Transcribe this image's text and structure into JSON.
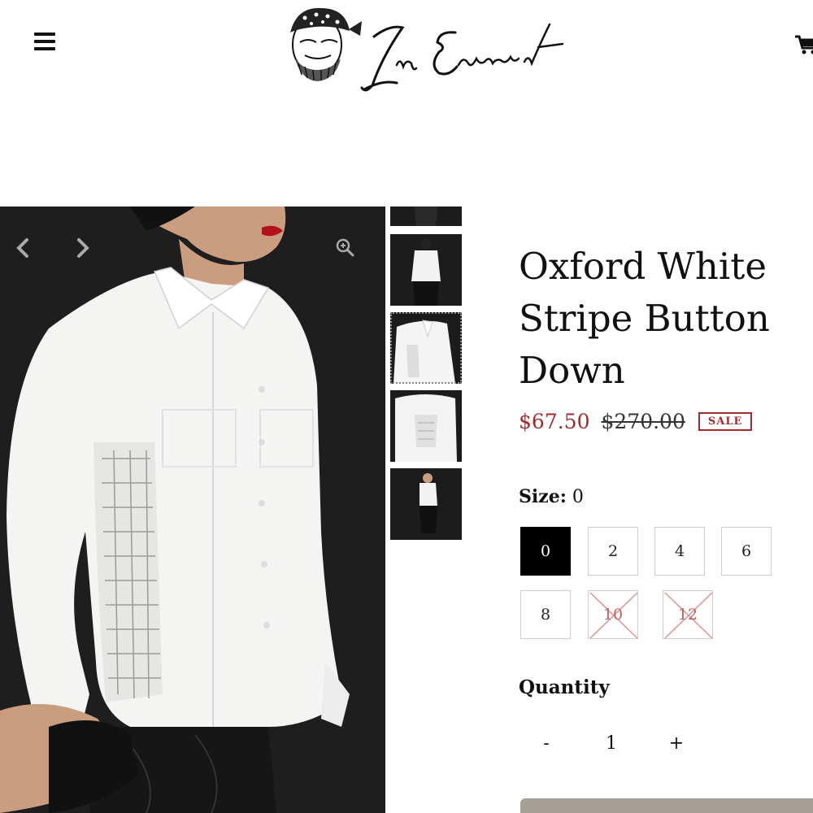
{
  "header": {
    "brand": "In Earnest",
    "menu_icon": "hamburger-menu-icon",
    "cart_icon": "shopping-cart-icon"
  },
  "gallery": {
    "prev_icon": "chevron-left-icon",
    "next_icon": "chevron-right-icon",
    "zoom_icon": "zoom-in-icon",
    "thumbnails": [
      "thumbnail-1",
      "thumbnail-2",
      "thumbnail-3",
      "thumbnail-4",
      "thumbnail-5"
    ]
  },
  "product": {
    "title": "Oxford White\nStripe Button\nDown",
    "sale_price": "$67.50",
    "original_price": "$270.00",
    "badge": "SALE",
    "accent_color": "#a52a2a"
  },
  "size": {
    "label": "Size:",
    "selected": "0",
    "options": [
      {
        "value": "0",
        "state": "selected"
      },
      {
        "value": "2",
        "state": "available"
      },
      {
        "value": "4",
        "state": "available"
      },
      {
        "value": "6",
        "state": "available"
      },
      {
        "value": "8",
        "state": "available"
      },
      {
        "value": "10",
        "state": "sold-out"
      },
      {
        "value": "12",
        "state": "sold-out"
      }
    ]
  },
  "quantity": {
    "label": "Quantity",
    "minus": "-",
    "value": "1",
    "plus": "+"
  }
}
